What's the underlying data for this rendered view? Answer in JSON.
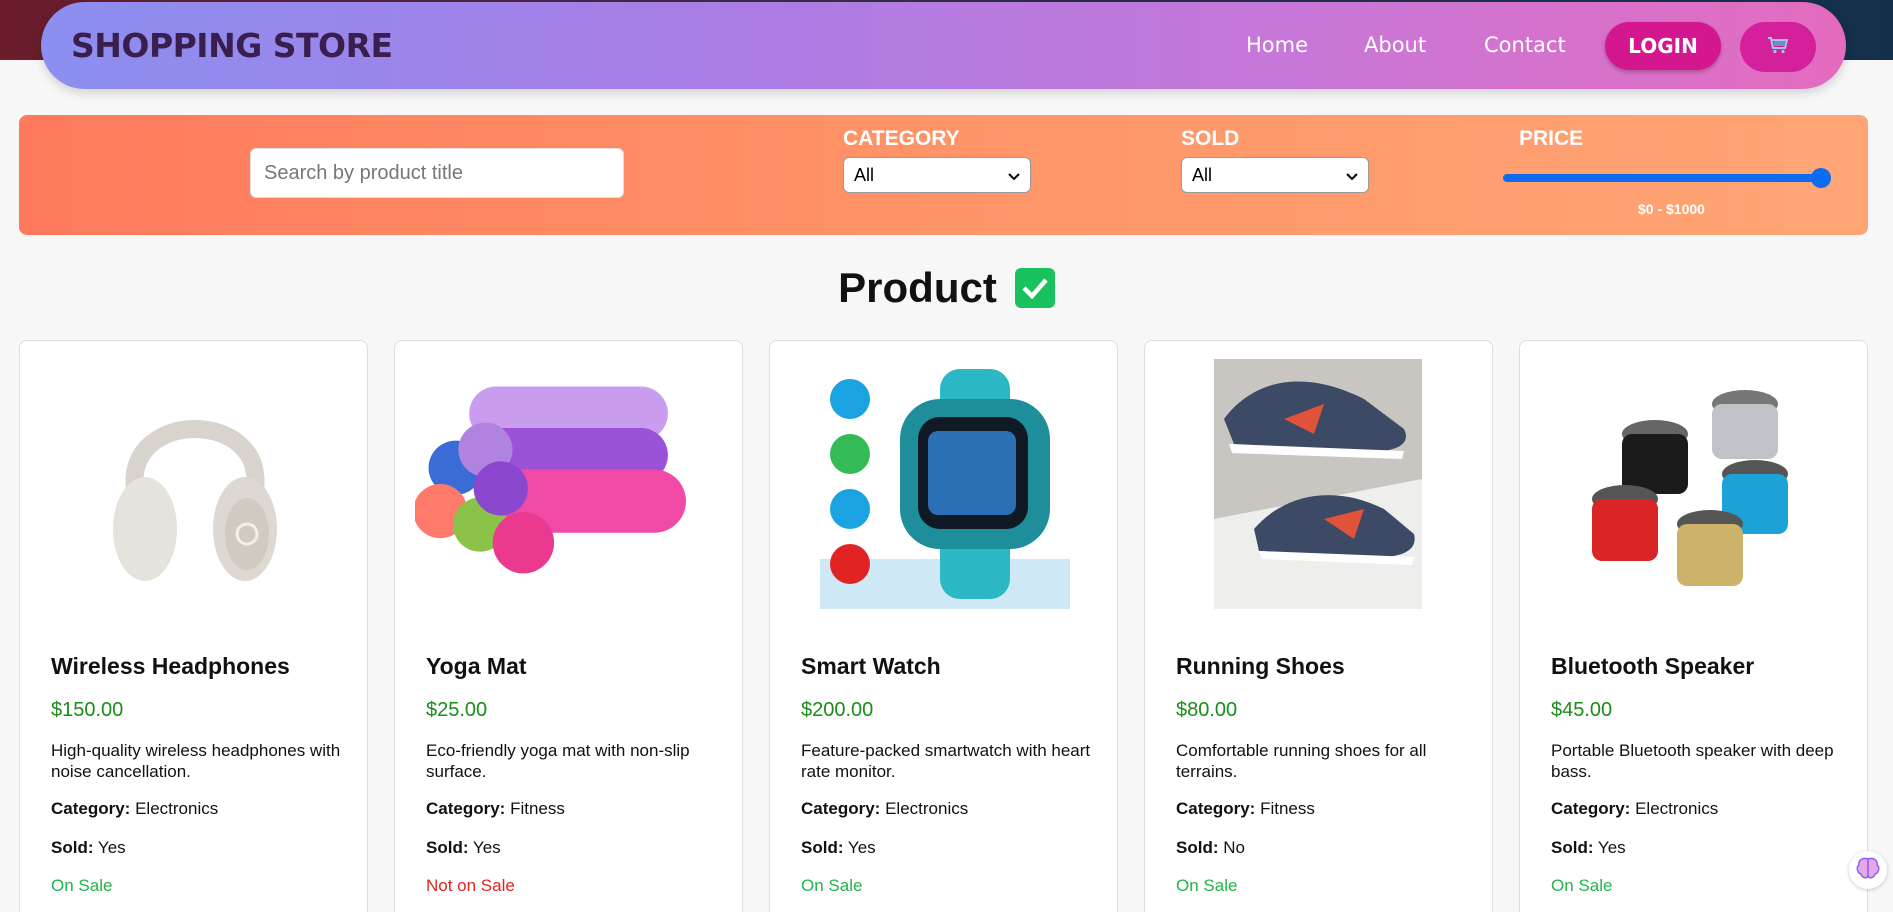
{
  "header": {
    "brand": "SHOPPING STORE",
    "nav": [
      "Home",
      "About",
      "Contact"
    ],
    "login_label": "LOGIN",
    "cart_icon": "cart-icon"
  },
  "filters": {
    "search_placeholder": "Search by product title",
    "category_label": "CATEGORY",
    "category_value": "All",
    "sold_label": "SOLD",
    "sold_value": "All",
    "price_label": "PRICE",
    "price_range": "$0 - $1000",
    "price_slider_fraction": 1.0
  },
  "section": {
    "title": "Product",
    "icon": "checkmark-icon"
  },
  "products": [
    {
      "title": "Wireless Headphones",
      "price": "$150.00",
      "desc": "High-quality wireless headphones with noise cancellation.",
      "category": "Electronics",
      "sold": "Yes",
      "sale": "On Sale",
      "image": "headphones-image"
    },
    {
      "title": "Yoga Mat",
      "price": "$25.00",
      "desc": "Eco-friendly yoga mat with non-slip surface.",
      "category": "Fitness",
      "sold": "Yes",
      "sale": "Not on Sale",
      "image": "yoga-mat-image"
    },
    {
      "title": "Smart Watch",
      "price": "$200.00",
      "desc": "Feature-packed smartwatch with heart rate monitor.",
      "category": "Electronics",
      "sold": "Yes",
      "sale": "On Sale",
      "image": "smart-watch-image"
    },
    {
      "title": "Running Shoes",
      "price": "$80.00",
      "desc": "Comfortable running shoes for all terrains.",
      "category": "Fitness",
      "sold": "No",
      "sale": "On Sale",
      "image": "running-shoes-image"
    },
    {
      "title": "Bluetooth Speaker",
      "price": "$45.00",
      "desc": "Portable Bluetooth speaker with deep bass.",
      "category": "Electronics",
      "sold": "Yes",
      "sale": "On Sale",
      "image": "bluetooth-speaker-image"
    }
  ],
  "labels": {
    "category": "Category:",
    "sold": "Sold:"
  },
  "colors": {
    "on_sale": "#25b34a",
    "not_on_sale": "#e02424",
    "price": "#1a8c1a",
    "accent": "#d4168f"
  }
}
